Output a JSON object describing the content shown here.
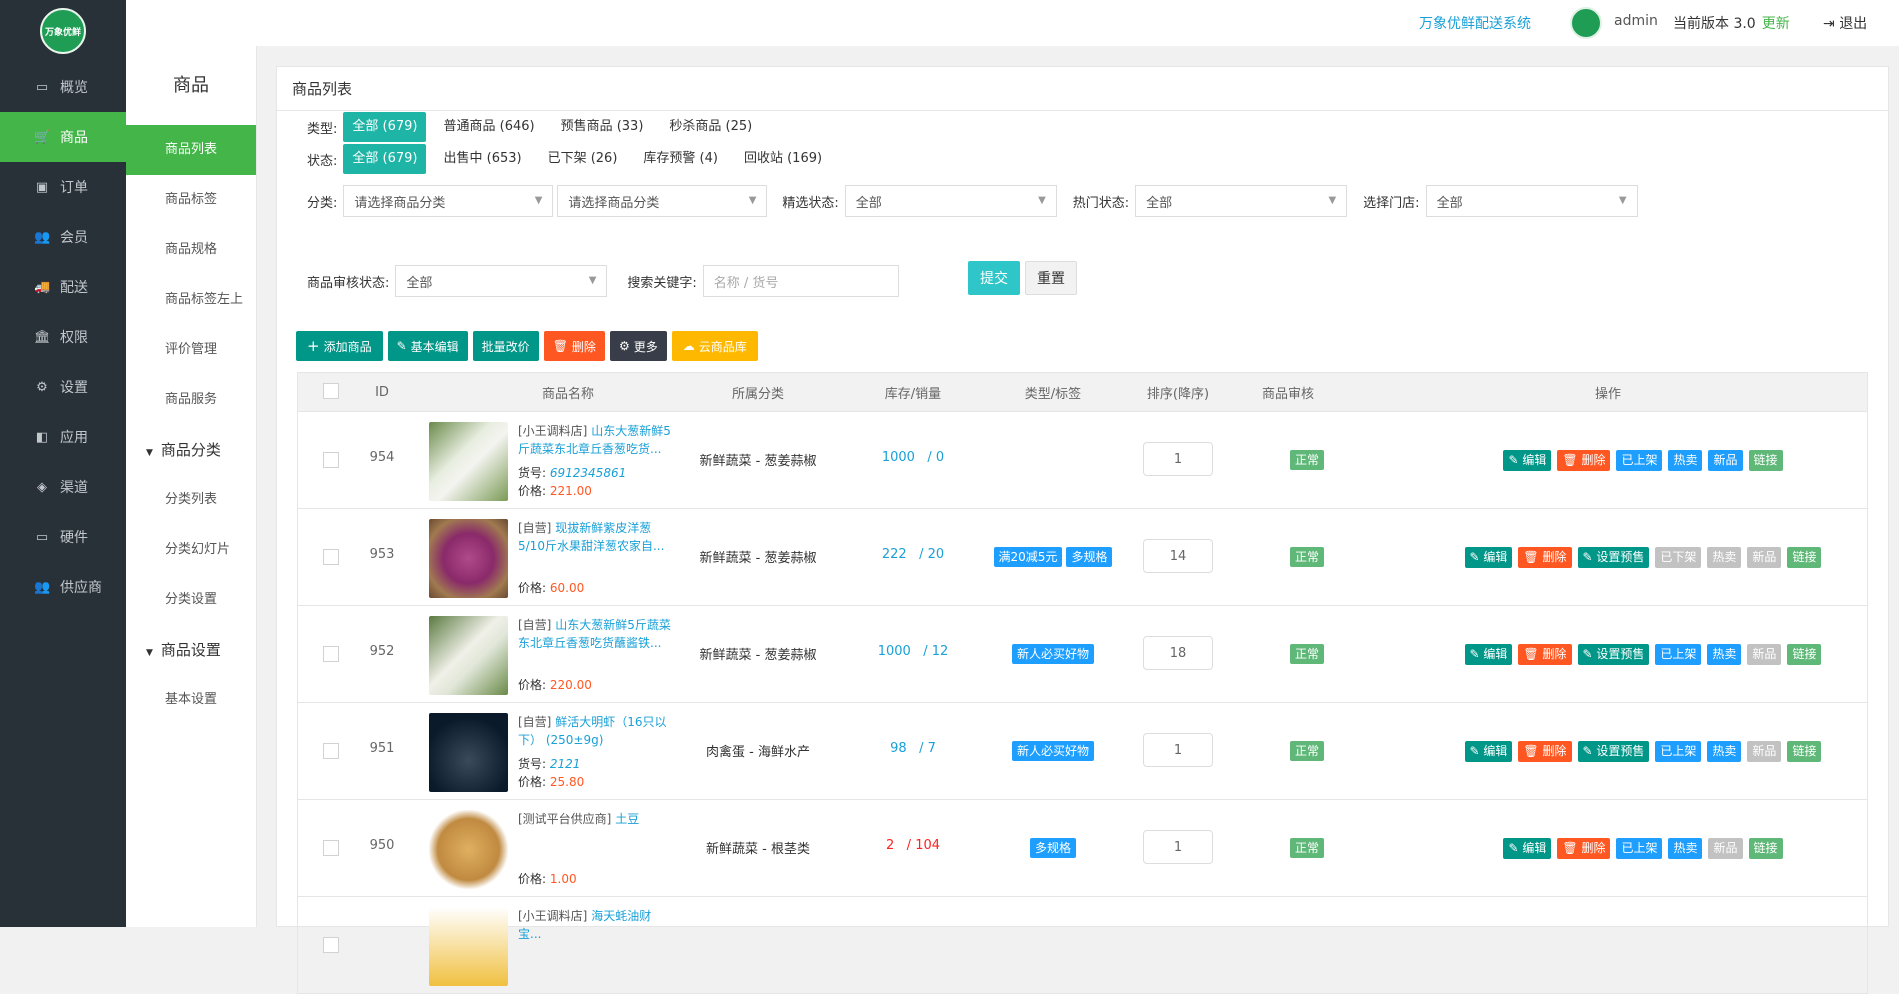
{
  "app": {
    "system_name": "万象优鲜配送系统",
    "user": "admin",
    "version_label": "当前版本",
    "version": "3.0",
    "update": "更新",
    "logout": "退出",
    "logo_text": "万象优鲜"
  },
  "sidebar": {
    "items": [
      {
        "label": "概览",
        "icon": "monitor-icon"
      },
      {
        "label": "商品",
        "icon": "cart-icon"
      },
      {
        "label": "订单",
        "icon": "order-icon"
      },
      {
        "label": "会员",
        "icon": "users-icon"
      },
      {
        "label": "配送",
        "icon": "truck-icon"
      },
      {
        "label": "权限",
        "icon": "bank-icon"
      },
      {
        "label": "设置",
        "icon": "settings-icon"
      },
      {
        "label": "应用",
        "icon": "apps-icon"
      },
      {
        "label": "渠道",
        "icon": "box-icon"
      },
      {
        "label": "硬件",
        "icon": "monitor-icon"
      },
      {
        "label": "供应商",
        "icon": "users-icon"
      }
    ]
  },
  "subnav": {
    "title": "商品",
    "items": [
      "商品列表",
      "商品标签",
      "商品规格",
      "商品标签左上",
      "评价管理",
      "商品服务"
    ],
    "group1": "商品分类",
    "group1_items": [
      "分类列表",
      "分类幻灯片",
      "分类设置"
    ],
    "group2": "商品设置",
    "group2_items": [
      "基本设置"
    ]
  },
  "panel": {
    "title": "商品列表"
  },
  "filters": {
    "type_label": "类型:",
    "types": [
      "全部 (679)",
      "普通商品 (646)",
      "预售商品 (33)",
      "秒杀商品 (25)"
    ],
    "status_label": "状态:",
    "statuses": [
      "全部 (679)",
      "出售中 (653)",
      "已下架 (26)",
      "库存预警 (4)",
      "回收站 (169)"
    ],
    "category_label": "分类:",
    "category_placeholder": "请选择商品分类",
    "featured_label": "精选状态:",
    "hot_label": "热门状态:",
    "store_label": "选择门店:",
    "all": "全部",
    "audit_label": "商品审核状态:",
    "keyword_label": "搜索关键字:",
    "keyword_placeholder": "名称 / 货号",
    "submit": "提交",
    "reset": "重置"
  },
  "toolbar": {
    "add": "添加商品",
    "basic_edit": "基本编辑",
    "batch_price": "批量改价",
    "delete": "删除",
    "more": "更多",
    "cloud": "云商品库"
  },
  "table": {
    "headers": [
      "ID",
      "商品名称",
      "所属分类",
      "库存/销量",
      "类型/标签",
      "排序(降序)",
      "商品审核",
      "操作"
    ],
    "code_label": "货号:",
    "price_label": "价格:",
    "rows": [
      {
        "id": "954",
        "shop": "[小王调料店]",
        "title": "山东大葱新鲜5斤蔬菜东北章丘香葱吃货...",
        "code": "6912345861",
        "price": "221.00",
        "category": "新鲜蔬菜 - 葱姜蒜椒",
        "stock": "1000",
        "sales": "0",
        "tags": [],
        "sort": "1",
        "audit": "正常",
        "ops": [
          {
            "t": "编辑",
            "c": "edit"
          },
          {
            "t": "删除",
            "c": "del"
          },
          {
            "t": "已上架",
            "c": "blue"
          },
          {
            "t": "热卖",
            "c": "blue"
          },
          {
            "t": "新品",
            "c": "blue"
          },
          {
            "t": "链接",
            "c": "green"
          }
        ]
      },
      {
        "id": "953",
        "shop": "[自营]",
        "title": "现拔新鲜紫皮洋葱5/10斤水果甜洋葱农家自...",
        "code": "",
        "price": "60.00",
        "category": "新鲜蔬菜 - 葱姜蒜椒",
        "stock": "222",
        "sales": "20",
        "tags": [
          "满20减5元",
          "多规格"
        ],
        "sort": "14",
        "audit": "正常",
        "ops": [
          {
            "t": "编辑",
            "c": "edit"
          },
          {
            "t": "删除",
            "c": "del"
          },
          {
            "t": "设置预售",
            "c": "edit"
          },
          {
            "t": "已下架",
            "c": "gray"
          },
          {
            "t": "热卖",
            "c": "gray"
          },
          {
            "t": "新品",
            "c": "gray"
          },
          {
            "t": "链接",
            "c": "green"
          }
        ]
      },
      {
        "id": "952",
        "shop": "[自营]",
        "title": "山东大葱新鲜5斤蔬菜东北章丘香葱吃货蘸酱铁...",
        "code": "",
        "price": "220.00",
        "category": "新鲜蔬菜 - 葱姜蒜椒",
        "stock": "1000",
        "sales": "12",
        "tags": [
          "新人必买好物"
        ],
        "sort": "18",
        "audit": "正常",
        "ops": [
          {
            "t": "编辑",
            "c": "edit"
          },
          {
            "t": "删除",
            "c": "del"
          },
          {
            "t": "设置预售",
            "c": "edit"
          },
          {
            "t": "已上架",
            "c": "blue"
          },
          {
            "t": "热卖",
            "c": "blue"
          },
          {
            "t": "新品",
            "c": "gray"
          },
          {
            "t": "链接",
            "c": "green"
          }
        ]
      },
      {
        "id": "951",
        "shop": "[自营]",
        "title": "鲜活大明虾（16只以下） (250±9g)",
        "code": "2121",
        "price": "25.80",
        "category": "肉禽蛋 - 海鲜水产",
        "stock": "98",
        "sales": "7",
        "tags": [
          "新人必买好物"
        ],
        "sort": "1",
        "audit": "正常",
        "ops": [
          {
            "t": "编辑",
            "c": "edit"
          },
          {
            "t": "删除",
            "c": "del"
          },
          {
            "t": "设置预售",
            "c": "edit"
          },
          {
            "t": "已上架",
            "c": "blue"
          },
          {
            "t": "热卖",
            "c": "blue"
          },
          {
            "t": "新品",
            "c": "gray"
          },
          {
            "t": "链接",
            "c": "green"
          }
        ]
      },
      {
        "id": "950",
        "shop": "[测试平台供应商]",
        "title": "土豆",
        "code": "",
        "price": "1.00",
        "category": "新鲜蔬菜 - 根茎类",
        "stock": "2",
        "sales": "104",
        "tags": [
          "多规格"
        ],
        "sort": "1",
        "audit": "正常",
        "stock_warn": true,
        "ops": [
          {
            "t": "编辑",
            "c": "edit"
          },
          {
            "t": "删除",
            "c": "del"
          },
          {
            "t": "已上架",
            "c": "blue"
          },
          {
            "t": "热卖",
            "c": "blue"
          },
          {
            "t": "新品",
            "c": "gray"
          },
          {
            "t": "链接",
            "c": "green"
          }
        ]
      },
      {
        "id": "",
        "shop": "[小王调料店]",
        "title": "海天蚝油财宝...",
        "code": "",
        "price": "",
        "category": "",
        "stock": "",
        "sales": "",
        "tags": [],
        "sort": "",
        "audit": "",
        "ops": []
      }
    ]
  },
  "colors": {
    "sidebar": "#283038",
    "accent": "#44b549",
    "teal": "#009688",
    "red": "#ff5722",
    "blue": "#1e9fff"
  }
}
